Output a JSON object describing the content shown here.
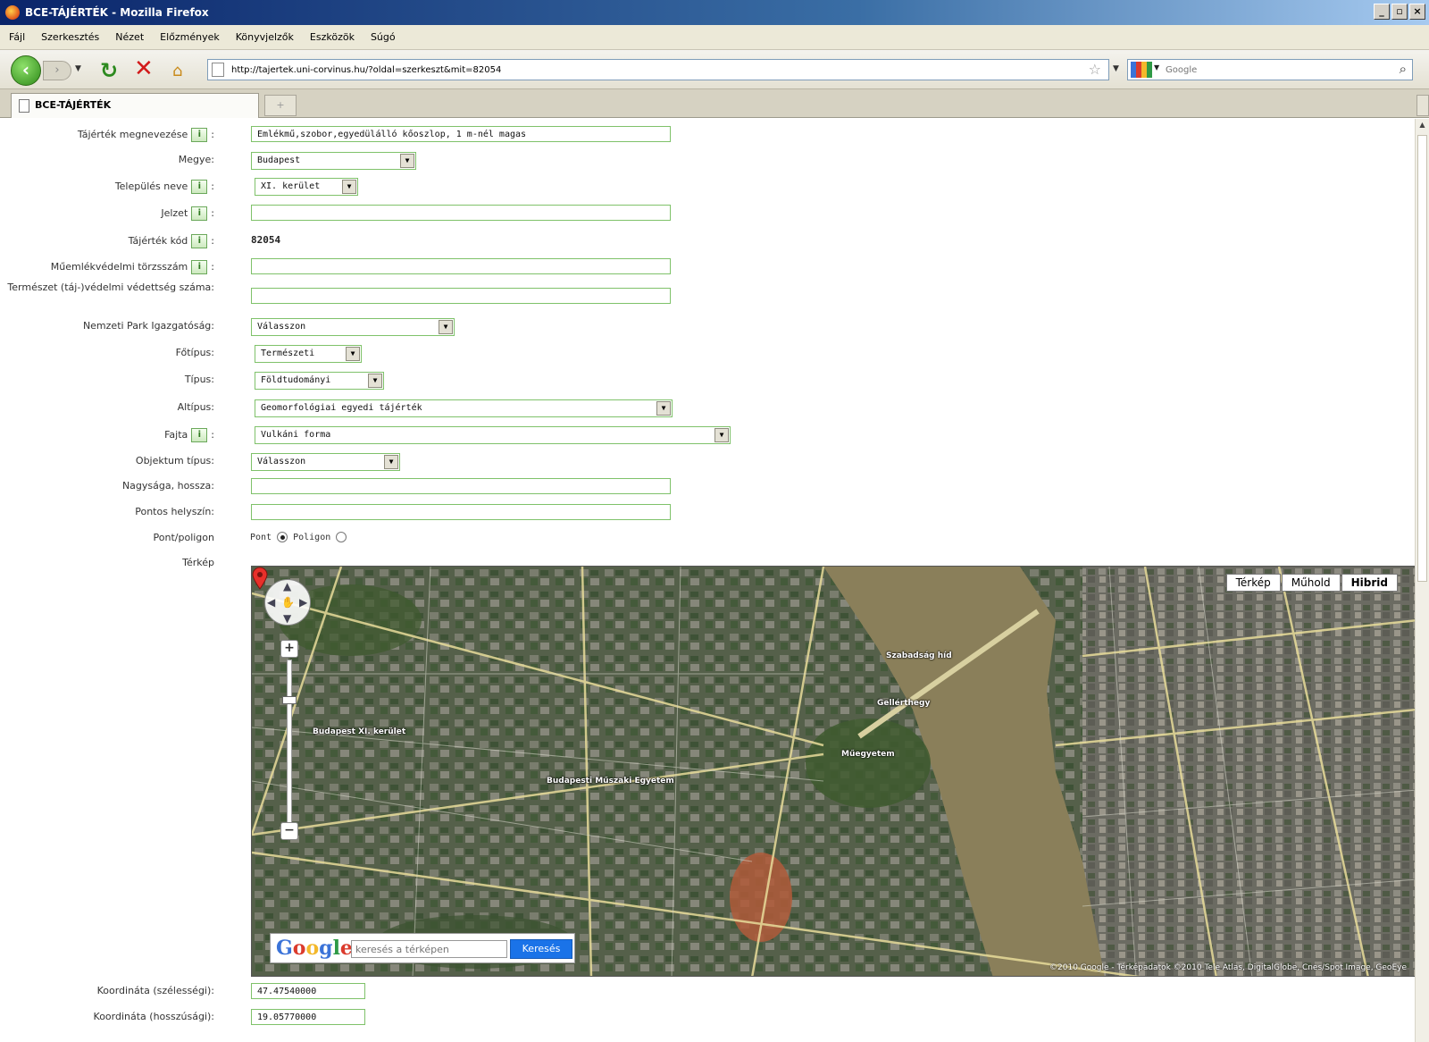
{
  "window": {
    "title": "BCE-TÁJÉRTÉK - Mozilla Firefox",
    "controls": [
      "_",
      "▫",
      "×"
    ]
  },
  "menu": [
    "Fájl",
    "Szerkesztés",
    "Nézet",
    "Előzmények",
    "Könyvjelzők",
    "Eszközök",
    "Súgó"
  ],
  "nav": {
    "url": "http://tajertek.uni-corvinus.hu/?oldal=szerkeszt&mit=82054",
    "search_placeholder": "Google"
  },
  "tab": {
    "label": "BCE-TÁJÉRTÉK"
  },
  "form": {
    "name_label": "Tájérték megnevezése",
    "name_value": "Emlékmű,szobor,egyedülálló kőoszlop, 1 m-nél magas",
    "county_label": "Megye:",
    "county_value": "Budapest",
    "settlement_label": "Település neve",
    "settlement_value": "XI. kerület",
    "mark_label": "Jelzet",
    "mark_value": "",
    "code_label": "Tájérték kód",
    "code_value": "82054",
    "monument_label": "Műemlékvédelmi törzsszám",
    "monument_value": "",
    "nature_label": "Természet (táj-)védelmi védettség száma:",
    "nature_value": "",
    "np_label": "Nemzeti Park Igazgatóság:",
    "np_value": "Válasszon",
    "maintype_label": "Főtípus:",
    "maintype_value": "Természeti",
    "type_label": "Típus:",
    "type_value": "Földtudományi",
    "subtype_label": "Altípus:",
    "subtype_value": "Geomorfológiai egyedi tájérték",
    "kind_label": "Fajta",
    "kind_value": "Vulkáni forma",
    "objtype_label": "Objektum típus:",
    "objtype_value": "Válasszon",
    "size_label": "Nagysága, hossza:",
    "size_value": "",
    "location_label": "Pontos helyszín:",
    "location_value": "",
    "pointpoly_label": "Pont/poligon",
    "point_label": "Pont",
    "polygon_label": "Poligon",
    "map_label": "Térkép",
    "lat_label": "Koordináta (szélességi):",
    "lat_value": "47.47540000",
    "lon_label": "Koordináta (hosszúsági):",
    "lon_value": "19.05770000",
    "info_glyph": "i"
  },
  "map": {
    "types": [
      "Térkép",
      "Műhold",
      "Hibrid"
    ],
    "active_type": "Hibrid",
    "search_placeholder": "keresés a térképen",
    "search_button": "Keresés",
    "google_logo": "Google",
    "places": [
      "Budapest XI. kerület",
      "Gellérthegy",
      "Szabadság híd",
      "Műegyetem",
      "Budapesti Műszaki Egyetem"
    ],
    "copyright": "©2010 Google - Térképadatok ©2010 Tele Atlas, DigitalGlobe, Cnes/Spot Image, GeoEye"
  },
  "colors": {
    "field_border": "#7fc26a",
    "river": "#8a7f5a",
    "accent_blue": "#1a73e8"
  }
}
